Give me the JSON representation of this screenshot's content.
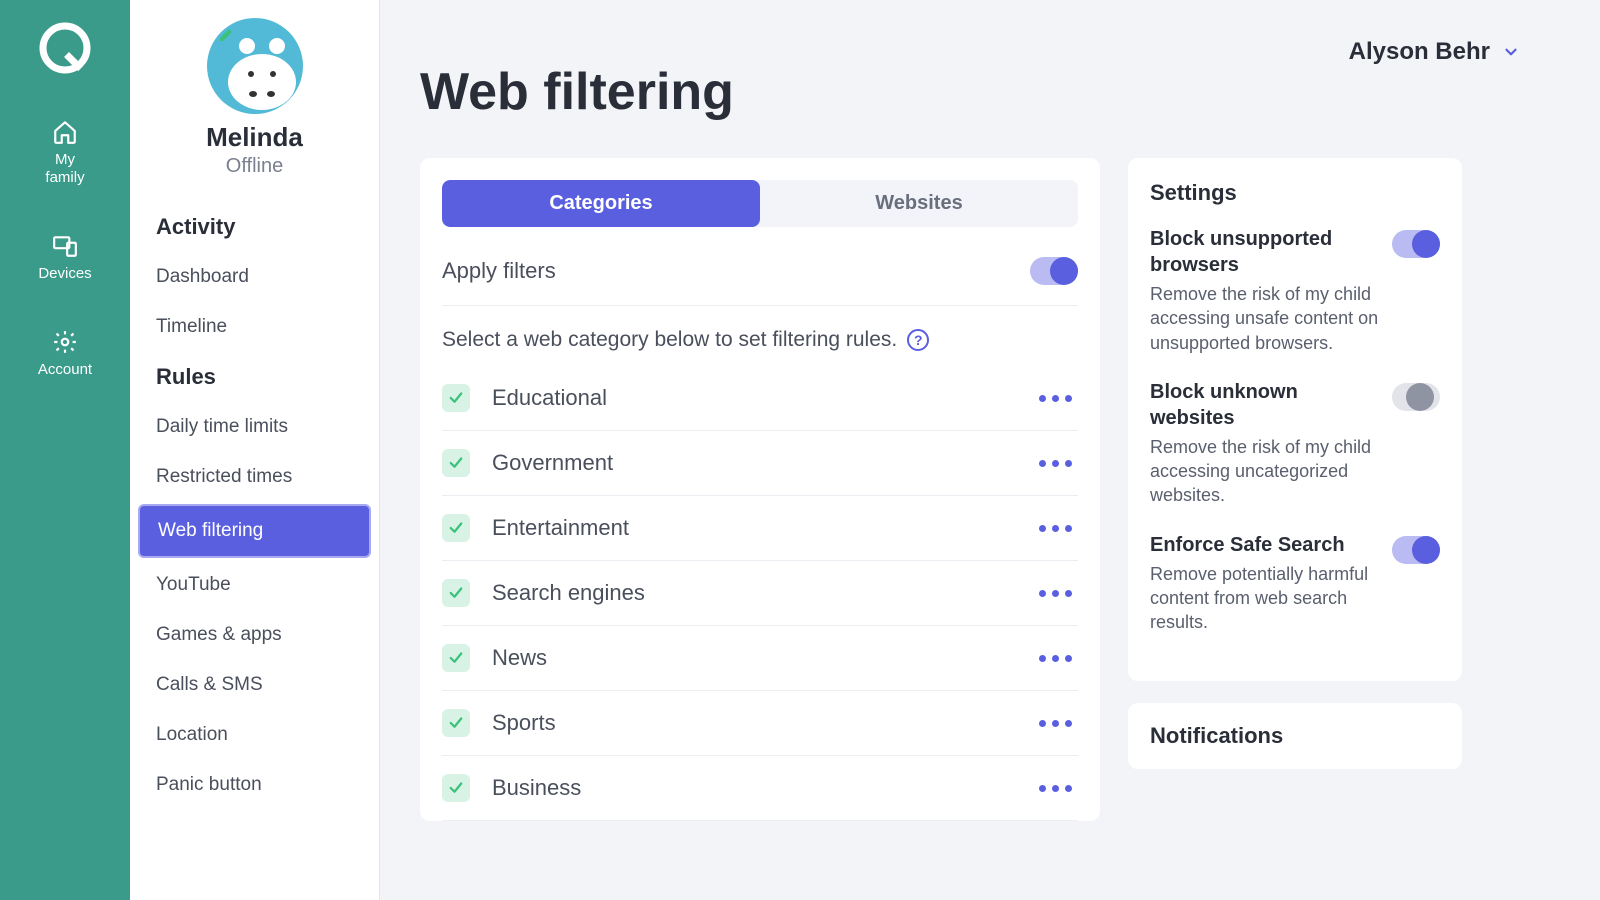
{
  "rail": {
    "items": [
      {
        "label": "My\nfamily"
      },
      {
        "label": "Devices"
      },
      {
        "label": "Account"
      }
    ]
  },
  "profile": {
    "name": "Melinda",
    "status": "Offline"
  },
  "nav": {
    "heading1": "Activity",
    "activity": [
      {
        "label": "Dashboard"
      },
      {
        "label": "Timeline"
      }
    ],
    "heading2": "Rules",
    "rules": [
      {
        "label": "Daily time limits"
      },
      {
        "label": "Restricted times"
      },
      {
        "label": "Web filtering"
      },
      {
        "label": "YouTube"
      },
      {
        "label": "Games & apps"
      },
      {
        "label": "Calls & SMS"
      },
      {
        "label": "Location"
      },
      {
        "label": "Panic button"
      }
    ]
  },
  "header": {
    "page_title": "Web filtering",
    "user": "Alyson Behr"
  },
  "tabs": {
    "categories": "Categories",
    "websites": "Websites"
  },
  "apply_filters_label": "Apply filters",
  "help_text": "Select a web category below to set filtering rules.",
  "categories": [
    {
      "name": "Educational",
      "checked": true
    },
    {
      "name": "Government",
      "checked": true
    },
    {
      "name": "Entertainment",
      "checked": true
    },
    {
      "name": "Search engines",
      "checked": true
    },
    {
      "name": "News",
      "checked": true
    },
    {
      "name": "Sports",
      "checked": true
    },
    {
      "name": "Business",
      "checked": true
    }
  ],
  "settings": {
    "title": "Settings",
    "items": [
      {
        "title": "Block unsupported browsers",
        "desc": "Remove the risk of my child accessing unsafe content on unsupported browsers.",
        "on": true
      },
      {
        "title": "Block unknown websites",
        "desc": "Remove the risk of my child accessing uncategorized websites.",
        "on": false
      },
      {
        "title": "Enforce Safe Search",
        "desc": "Remove potentially harmful content from web search results.",
        "on": true
      }
    ]
  },
  "notifications_title": "Notifications"
}
